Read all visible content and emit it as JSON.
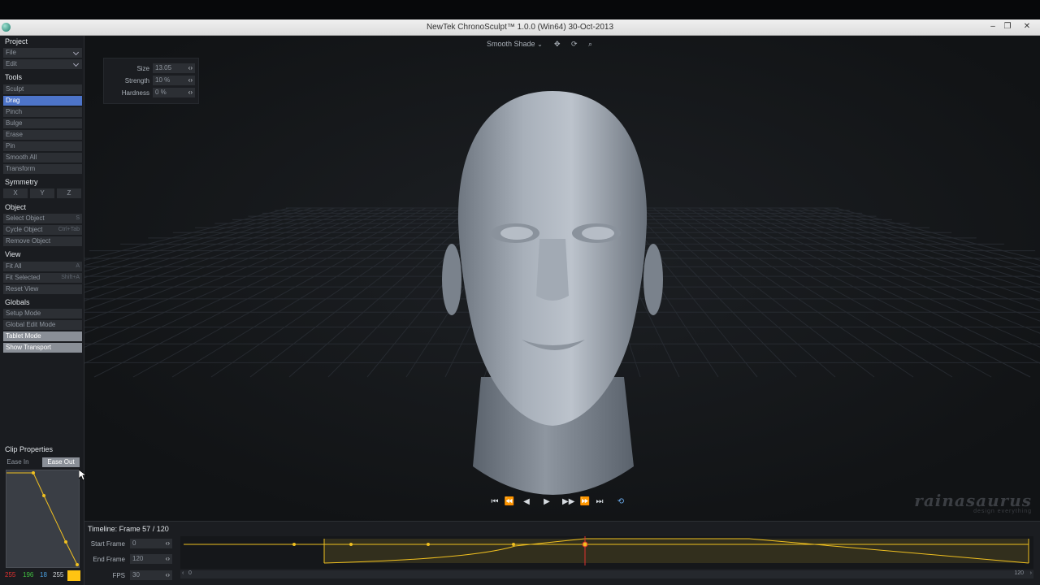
{
  "window": {
    "title": "NewTek ChronoSculpt™ 1.0.0 (Win64) 30-Oct-2013",
    "min_icon": "minimize-icon",
    "max_icon": "maximize-icon",
    "close_icon": "close-icon"
  },
  "sidebar": {
    "project": {
      "title": "Project",
      "items": [
        {
          "label": "File"
        },
        {
          "label": "Edit"
        }
      ]
    },
    "tools": {
      "title": "Tools",
      "items": [
        {
          "label": "Sculpt"
        },
        {
          "label": "Drag",
          "active": true
        },
        {
          "label": "Pinch"
        },
        {
          "label": "Bulge"
        },
        {
          "label": "Erase"
        },
        {
          "label": "Pin"
        },
        {
          "label": "Smooth All"
        },
        {
          "label": "Transform"
        }
      ]
    },
    "symmetry": {
      "title": "Symmetry",
      "axes": [
        "X",
        "Y",
        "Z"
      ]
    },
    "object": {
      "title": "Object",
      "items": [
        {
          "label": "Select Object",
          "shortcut": "S"
        },
        {
          "label": "Cycle Object",
          "shortcut": "Ctrl+Tab"
        },
        {
          "label": "Remove Object"
        }
      ]
    },
    "view": {
      "title": "View",
      "items": [
        {
          "label": "Fit All",
          "shortcut": "A"
        },
        {
          "label": "Fit Selected",
          "shortcut": "Shift+A"
        },
        {
          "label": "Reset View"
        }
      ]
    },
    "globals": {
      "title": "Globals",
      "items": [
        {
          "label": "Setup Mode"
        },
        {
          "label": "Global Edit Mode"
        },
        {
          "label": "Tablet Mode"
        },
        {
          "label": "Show Transport"
        }
      ]
    },
    "clip": {
      "title": "Clip Properties",
      "ease_in": "Ease In",
      "ease_out": "Ease Out",
      "rgb": {
        "r": "255",
        "g": "196",
        "b": "18",
        "a": "255"
      },
      "swatch_color": "#ffc412"
    }
  },
  "viewport": {
    "shade_mode": "Smooth Shade",
    "toolbar_icons": [
      "move-icon",
      "rotate-icon",
      "zoom-icon"
    ],
    "brush": {
      "size_label": "Size",
      "size_value": "13.05",
      "strength_label": "Strength",
      "strength_value": "10 %",
      "hardness_label": "Hardness",
      "hardness_value": "0 %"
    },
    "transport_icons": [
      "go-to-start-icon",
      "step-back-icon",
      "play-reverse-icon",
      "play-icon",
      "play-forward-icon",
      "step-forward-icon",
      "go-to-end-icon",
      "loop-icon"
    ],
    "watermark": {
      "brand": "rainasaurus",
      "tagline": "design everything"
    }
  },
  "timeline": {
    "title": "Timeline: Frame 57 / 120",
    "current_frame": 57,
    "start_label": "Start Frame",
    "start_value": "0",
    "end_label": "End Frame",
    "end_value": "120",
    "fps_label": "FPS",
    "fps_value": "30",
    "scroll_start": "0",
    "scroll_end": "120",
    "accent_color": "#f0c020"
  }
}
